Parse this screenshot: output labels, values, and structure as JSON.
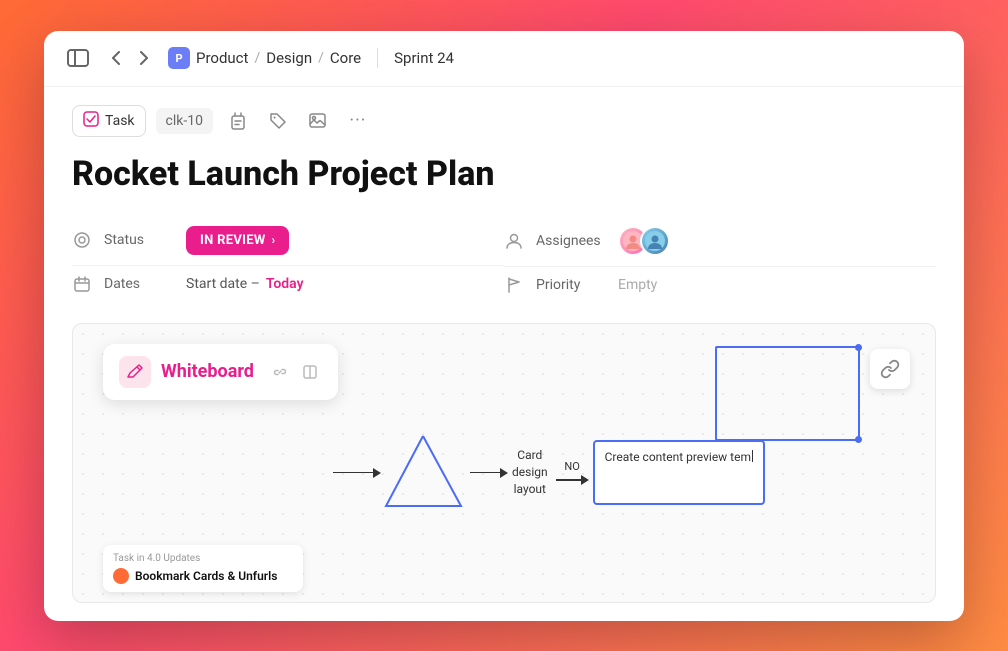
{
  "window": {
    "background_gradient": "linear-gradient(135deg, #ff6b35, #ff4a6e, #ff8c42)"
  },
  "header": {
    "breadcrumb_icon": "P",
    "breadcrumb_product": "Product",
    "sep1": "/",
    "breadcrumb_design": "Design",
    "sep2": "/",
    "breadcrumb_core": "Core",
    "sprint_label": "Sprint 24"
  },
  "toolbar": {
    "task_label": "Task",
    "task_id": "clk-10",
    "icons": [
      "timer-icon",
      "tag-icon",
      "image-icon",
      "more-icon"
    ]
  },
  "page": {
    "title": "Rocket Launch Project Plan"
  },
  "properties": {
    "left": [
      {
        "id": "status",
        "icon": "circle-dot-icon",
        "label": "Status",
        "value": "IN REVIEW",
        "type": "badge"
      },
      {
        "id": "dates",
        "icon": "calendar-icon",
        "label": "Dates",
        "value": "Start date – Today",
        "type": "date"
      }
    ],
    "right": [
      {
        "id": "assignees",
        "icon": "person-icon",
        "label": "Assignees",
        "type": "avatars"
      },
      {
        "id": "priority",
        "icon": "flag-icon",
        "label": "Priority",
        "value": "Empty",
        "type": "empty"
      }
    ]
  },
  "canvas": {
    "whiteboard_label": "Whiteboard",
    "task_badge": "Task in 4.0 Updates",
    "task_title": "Bookmark Cards & Unfurls",
    "flow_nodes": [
      {
        "id": "triangle",
        "type": "triangle"
      },
      {
        "id": "card-design",
        "type": "text",
        "line1": "Card",
        "line2": "design",
        "line3": "layout"
      },
      {
        "id": "no-label",
        "label": "NO"
      },
      {
        "id": "create-content",
        "text": "Create content preview tem"
      }
    ],
    "link_icon": "🔗"
  },
  "icons": {
    "sidebar": "⊟",
    "back": "‹",
    "forward": "›",
    "check": "✓",
    "timer": "⏳",
    "tag": "◇",
    "image": "⊡",
    "more": "···",
    "chevron_right": "›",
    "circle_dot": "◎",
    "calendar": "▦",
    "person": "⊙",
    "flag": "⚑",
    "link": "⛓",
    "whiteboard_pencil": "✏"
  }
}
